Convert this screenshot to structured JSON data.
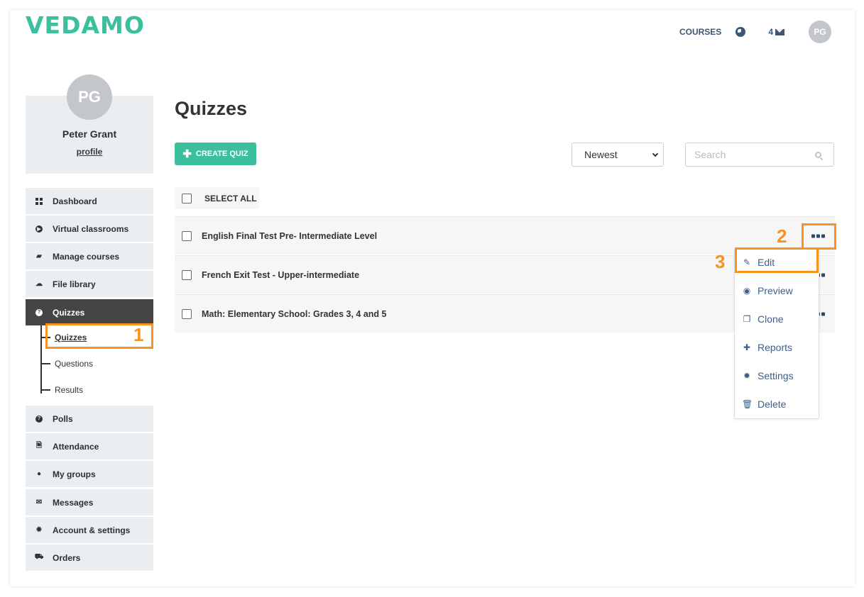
{
  "brand": {
    "logo_text": "VEDAMO",
    "accent_color": "#3bbf9c",
    "annotation_color": "#f7931e"
  },
  "topnav": {
    "courses_label": "COURSES",
    "globe_icon": "globe-icon",
    "messages_count": "4",
    "messages_icon": "envelope-icon",
    "avatar_initials": "PG"
  },
  "profile": {
    "initials": "PG",
    "name": "Peter Grant",
    "link_label": "profile"
  },
  "sidebar": {
    "items": [
      {
        "label": "Dashboard",
        "icon": "grid-icon"
      },
      {
        "label": "Virtual classrooms",
        "icon": "play-circle-icon"
      },
      {
        "label": "Manage courses",
        "icon": "book-icon"
      },
      {
        "label": "File library",
        "icon": "cloud-upload-icon"
      },
      {
        "label": "Quizzes",
        "icon": "question-circle-icon",
        "active": true
      },
      {
        "label": "Polls",
        "icon": "question-circle-icon"
      },
      {
        "label": "Attendance",
        "icon": "document-icon"
      },
      {
        "label": "My groups",
        "icon": "users-icon"
      },
      {
        "label": "Messages",
        "icon": "envelope-icon"
      },
      {
        "label": "Account & settings",
        "icon": "gear-icon"
      },
      {
        "label": "Orders",
        "icon": "cart-icon"
      }
    ],
    "quizzes_sub": [
      {
        "label": "Quizzes",
        "current": true
      },
      {
        "label": "Questions"
      },
      {
        "label": "Results"
      }
    ]
  },
  "main": {
    "title": "Quizzes",
    "create_button": "CREATE QUIZ",
    "sort": {
      "selected": "Newest"
    },
    "search": {
      "placeholder": "Search",
      "value": ""
    },
    "select_all_label": "SELECT ALL",
    "quizzes": [
      {
        "title": "English Final Test Pre- Intermediate Level"
      },
      {
        "title": "French Exit Test - Upper-intermediate"
      },
      {
        "title": "Math: Elementary School: Grades 3, 4 and 5"
      }
    ]
  },
  "action_menu": {
    "items": [
      {
        "label": "Edit",
        "icon": "pencil-icon"
      },
      {
        "label": "Preview",
        "icon": "eye-icon"
      },
      {
        "label": "Clone",
        "icon": "clone-icon"
      },
      {
        "label": "Reports",
        "icon": "plus-icon"
      },
      {
        "label": "Settings",
        "icon": "gear-icon"
      },
      {
        "label": "Delete",
        "icon": "trash-icon"
      }
    ]
  },
  "annotations": {
    "step1": "1",
    "step2": "2",
    "step3": "3"
  }
}
